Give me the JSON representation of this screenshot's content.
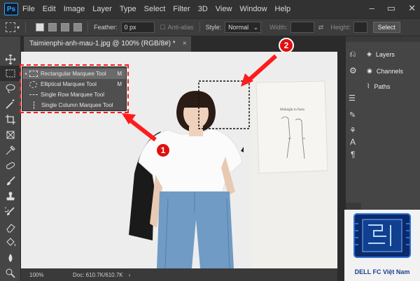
{
  "menu_items": [
    "File",
    "Edit",
    "Image",
    "Layer",
    "Type",
    "Select",
    "Filter",
    "3D",
    "View",
    "Window",
    "Help"
  ],
  "app_logo_text": "Ps",
  "options": {
    "feather_label": "Feather:",
    "feather_value": "0 px",
    "antialias_label": "Anti-alias",
    "style_label": "Style:",
    "style_value": "Normal",
    "width_label": "Width:",
    "height_label": "Height:",
    "select_button": "Select"
  },
  "document_tab": {
    "title": "Taimienphi-anh-mau-1.jpg @ 100% (RGB/8#) *",
    "close": "×"
  },
  "marquee_menu": [
    {
      "label": "Rectangular Marquee Tool",
      "key": "M",
      "selected": true
    },
    {
      "label": "Elliptical Marquee Tool",
      "key": "M",
      "selected": false
    },
    {
      "label": "Single Row Marquee Tool",
      "key": "",
      "selected": false
    },
    {
      "label": "Single Column Marquee Tool",
      "key": "",
      "selected": false
    }
  ],
  "callouts": [
    "1",
    "2"
  ],
  "status": {
    "zoom": "100%",
    "doc": "Doc: 610.7K/610.7K"
  },
  "panels": {
    "layers": "Layers",
    "channels": "Channels",
    "paths": "Paths"
  },
  "artwork_text": "Midnight in Paris",
  "brand_text": "DELL FC Việt Nam",
  "colors": {
    "accent": "#31a8ff",
    "callout": "#e01010",
    "annotation": "#ff1b1b",
    "brand": "#1a3f8c"
  }
}
